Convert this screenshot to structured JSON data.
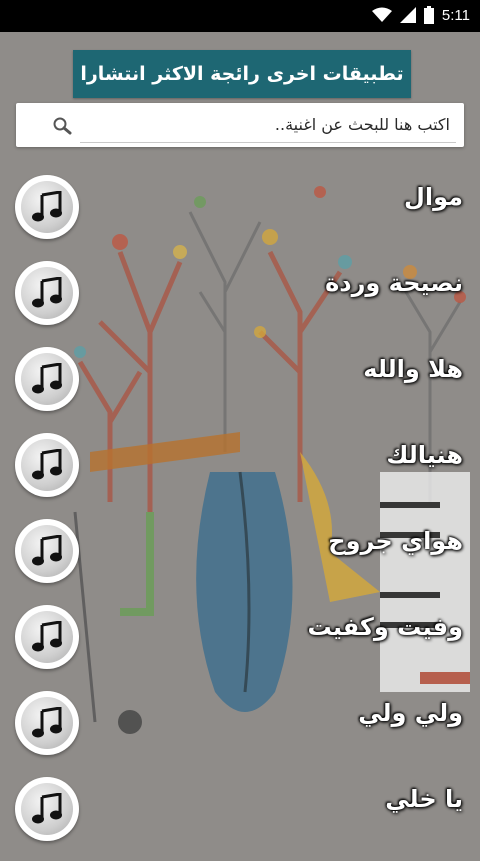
{
  "status_bar": {
    "time": "5:11",
    "icons": [
      "wifi-icon",
      "signal-icon",
      "battery-icon"
    ]
  },
  "promo": {
    "label": "تطبيقات اخرى رائجة الاكثر انتشارا"
  },
  "search": {
    "placeholder": "اكتب هنا للبحث عن اغنية..",
    "value": "",
    "icon": "search-icon"
  },
  "songs": [
    {
      "title": "موال"
    },
    {
      "title": "نصيحة وردة"
    },
    {
      "title": "هلا والله"
    },
    {
      "title": "هنيالك"
    },
    {
      "title": "هواي جروح"
    },
    {
      "title": "وفيت وكفيت"
    },
    {
      "title": "ولي ولي"
    },
    {
      "title": "يا خلي"
    }
  ],
  "colors": {
    "banner": "#1e6773",
    "background": "#8d8a87",
    "status_bar": "#000000"
  }
}
